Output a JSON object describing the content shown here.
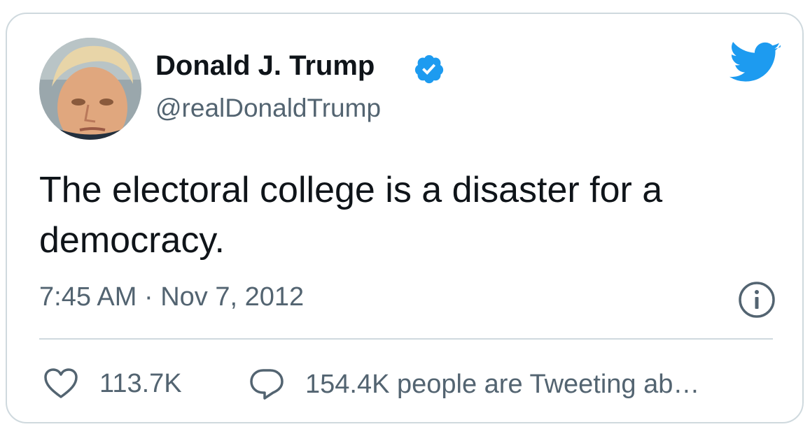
{
  "tweet": {
    "author": {
      "display_name": "Donald J. Trump",
      "handle": "@realDonaldTrump",
      "verified": true,
      "avatar_icon": "profile-avatar"
    },
    "text": "The electoral college is a disaster for a democracy.",
    "timestamp": "7:45 AM · Nov 7, 2012",
    "likes": "113.7K",
    "conversation": "154.4K people are Tweeting ab…"
  },
  "icons": {
    "brand": "twitter-bird-icon",
    "verified": "verified-badge-icon",
    "info": "info-icon",
    "like": "heart-icon",
    "reply": "speech-bubble-icon"
  },
  "colors": {
    "brand_blue": "#1d9bf0",
    "text_primary": "#0f1419",
    "text_secondary": "#536471",
    "border": "#cfd9de"
  }
}
